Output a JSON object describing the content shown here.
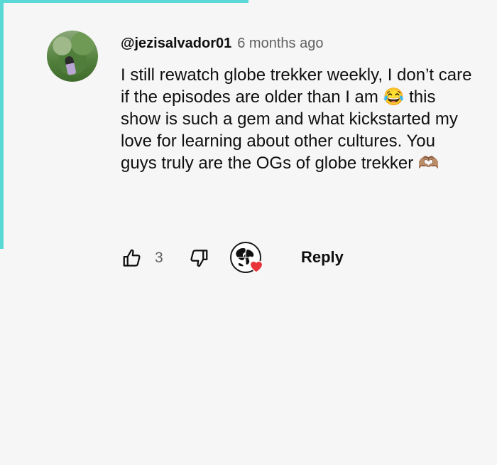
{
  "comment": {
    "author": "@jezisalvador01",
    "timestamp": "6 months ago",
    "text_before_emoji": "I still rewatch globe trekker weekly, I don’t care if the episodes are older than I am ",
    "emoji_1": "😂",
    "text_after_emoji": " this show is such a gem and what kickstarted my love for learning about other cultures. You guys truly are the OGs of globe trekker ",
    "emoji_2": "🫶🏽"
  },
  "actions": {
    "like_count": "3",
    "reply_label": "Reply"
  },
  "icons": {
    "like": "thumbs-up-icon",
    "dislike": "thumbs-down-icon",
    "creator_heart": "creator-heart-icon"
  },
  "colors": {
    "accent": "#5ad8d6",
    "heart": "#e8333b",
    "background": "#f6f6f6",
    "secondary_text": "#606060"
  }
}
